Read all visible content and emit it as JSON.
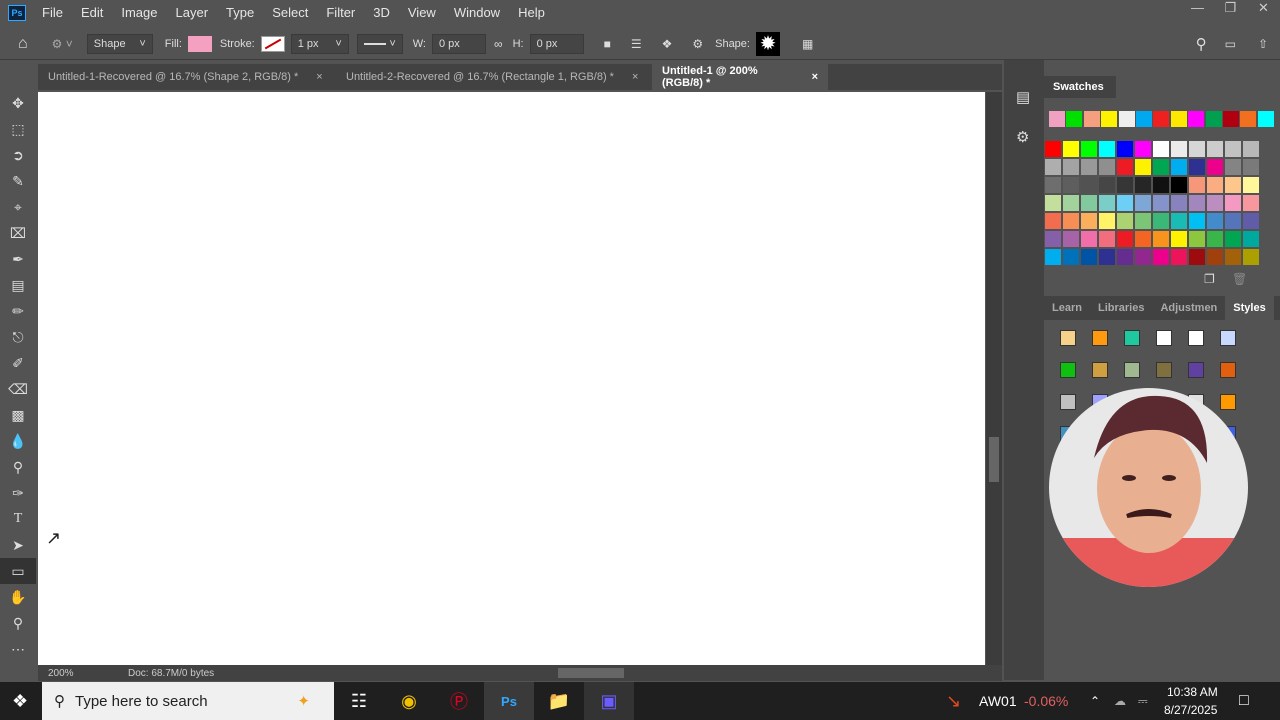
{
  "app": {
    "logo": "Ps",
    "menu": [
      "File",
      "Edit",
      "Image",
      "Layer",
      "Type",
      "Select",
      "Filter",
      "3D",
      "View",
      "Window",
      "Help"
    ]
  },
  "options": {
    "mode": "Shape",
    "fill_label": "Fill:",
    "fill_color": "#f4a0c0",
    "stroke_label": "Stroke:",
    "stroke_width": "1 px",
    "w_label": "W:",
    "w_value": "0 px",
    "h_label": "H:",
    "h_value": "0 px",
    "shape_label": "Shape:"
  },
  "tabs": [
    {
      "label": "Untitled-1-Recovered @ 16.7% (Shape 2, RGB/8) *",
      "active": false
    },
    {
      "label": "Untitled-2-Recovered @ 16.7% (Rectangle 1, RGB/8) *",
      "active": false
    },
    {
      "label": "Untitled-1 @ 200% (RGB/8) *",
      "active": true
    }
  ],
  "status": {
    "zoom": "200%",
    "doc": "Doc: 68.7M/0 bytes"
  },
  "swatches": {
    "title": "Swatches",
    "recent": [
      "#f0a0c0",
      "#00e000",
      "#f4a080",
      "#fff200",
      "#eeeeee",
      "#00a8f0",
      "#ee2020",
      "#ffe800",
      "#ff00ff",
      "#00a050",
      "#b00010",
      "#f07020",
      "#00ffff"
    ],
    "rows": [
      [
        "#ff0000",
        "#ffff00",
        "#00ff00",
        "#00ffff",
        "#0000ff",
        "#ff00ff",
        "#ffffff",
        "#ebebeb",
        "#d6d6d6",
        "#cccccc",
        "#c2c2c2",
        "#b8b8b8"
      ],
      [
        "#aeaeae",
        "#a3a3a3",
        "#999999",
        "#8f8f8f",
        "#ed1c24",
        "#fff200",
        "#00a651",
        "#00aeef",
        "#2e3192",
        "#ec008c",
        "#848484",
        "#7a7a7a"
      ],
      [
        "#6e6e6e",
        "#5e5e5e",
        "#525252",
        "#464646",
        "#363636",
        "#262626",
        "#111111",
        "#000000",
        "#f7977a",
        "#f9ad81",
        "#fdc68a",
        "#fff79a"
      ],
      [
        "#c4df9b",
        "#a3d39c",
        "#82ca9d",
        "#7bcdc8",
        "#6ecff6",
        "#7ea7d8",
        "#8493ca",
        "#8882be",
        "#a187be",
        "#bc8dbf",
        "#f49ac2",
        "#f6989d"
      ],
      [
        "#f26c4f",
        "#f68e55",
        "#fbaf5c",
        "#fff467",
        "#acd372",
        "#7cc576",
        "#3bb878",
        "#1abbb4",
        "#00bff3",
        "#438ccb",
        "#5574b9",
        "#605ca8"
      ],
      [
        "#855fa8",
        "#a763a8",
        "#f06ea9",
        "#f26d7d",
        "#ed1c24",
        "#f26522",
        "#f7941d",
        "#fff200",
        "#8dc63f",
        "#39b54a",
        "#00a651",
        "#00a99d"
      ],
      [
        "#00aeef",
        "#0072bc",
        "#0054a6",
        "#2e3192",
        "#662d91",
        "#92278f",
        "#ec008c",
        "#ed145b",
        "#9e0b0f",
        "#a0410d",
        "#a36209",
        "#aba000"
      ]
    ]
  },
  "panel_tabs": [
    "Learn",
    "Libraries",
    "Adjustmen",
    "Styles"
  ],
  "styles": [
    "#f7d08a",
    "#ff9a10",
    "#20c8a0",
    "#ffffff",
    "#ffffff",
    "#c8d8ff",
    "#10c010",
    "#d0a040",
    "#a0b890",
    "#807040",
    "#6040a0",
    "#e06010",
    "#c0c0c0",
    "#a0a0ff",
    "#e0e0e0",
    "#e0e0e0",
    "#e0e0e0",
    "#ff9900"
  ],
  "styles_bottom": [
    "#4090c0",
    "#10b0d0",
    "#e0e0e0",
    "#e0e0e0",
    "#e0e0e0",
    "#4060e0",
    "#2060c0",
    "#20a0f0",
    "#f0c060",
    "#80c080",
    "#f03030",
    "#f0c010",
    "#ffc000",
    "#666666",
    "#666666",
    "#40e0c0",
    "#b0a040",
    "#555555"
  ],
  "taskbar": {
    "search_placeholder": "Type here to search",
    "ticker": "AW01",
    "ticker_change": "-0.06%",
    "time": "10:38 AM",
    "date": "8/27/2025"
  }
}
